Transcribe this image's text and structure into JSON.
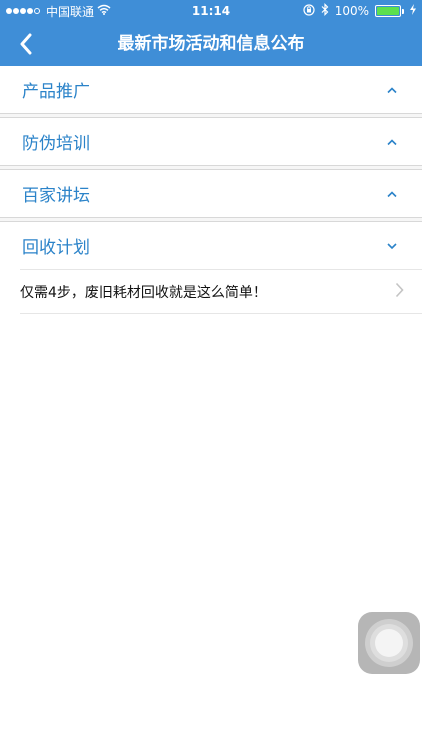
{
  "status_bar": {
    "carrier": "中国联通",
    "time": "11:14",
    "battery_percent": "100%",
    "signal_dots_filled": 4
  },
  "nav": {
    "title": "最新市场活动和信息公布"
  },
  "sections": [
    {
      "label": "产品推广",
      "expanded": false
    },
    {
      "label": "防伪培训",
      "expanded": false
    },
    {
      "label": "百家讲坛",
      "expanded": false
    },
    {
      "label": "回收计划",
      "expanded": true
    }
  ],
  "items": [
    {
      "label": "仅需4步，废旧耗材回收就是这么简单！"
    }
  ],
  "colors": {
    "nav_bg": "#3f8ed7",
    "section_text": "#2b83c9",
    "battery": "#5ce04e"
  }
}
